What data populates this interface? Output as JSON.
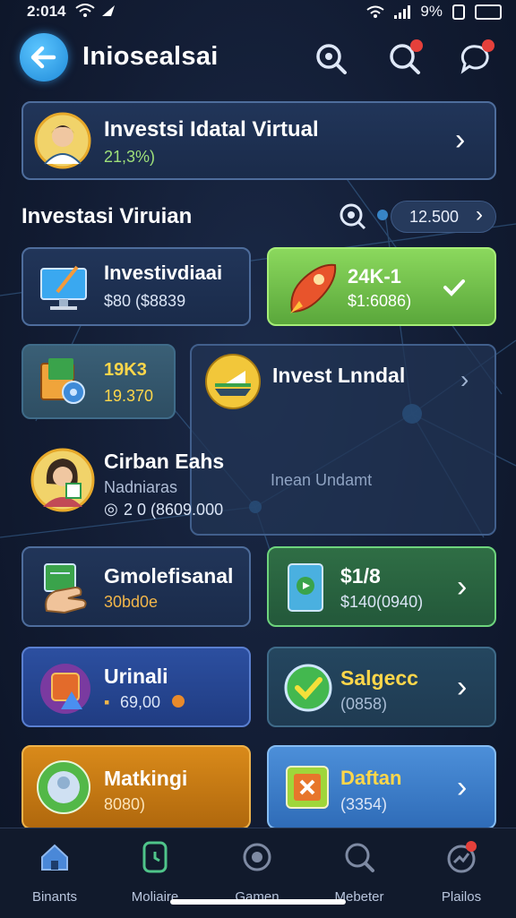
{
  "status_bar": {
    "time": "2:014",
    "battery": "9%"
  },
  "app_bar": {
    "title": "Iniosealsai"
  },
  "profile_card": {
    "title": "Investsi Idatal Virtual",
    "value": "21,3%)"
  },
  "section": {
    "title": "Investasi Viruian",
    "pill_value": "12.500"
  },
  "cards": [
    {
      "title": "Investivdiaai",
      "sub": "$80 ($8839"
    },
    {
      "title": "24K-1",
      "sub": "$1:6086)"
    },
    {
      "title": "19K3",
      "sub": "19.370"
    },
    {
      "title": "Invest Lnndal",
      "sub": ""
    },
    {
      "title": "Cirban Eahs",
      "sub": "Nadniaras",
      "amount": "2 0 (8609.000"
    },
    {
      "title": "Gmolefisanal",
      "sub": "30bd0e"
    },
    {
      "title": "$1/8",
      "sub": "$140(0940)"
    },
    {
      "title": "Urinali",
      "sub": "69,00"
    },
    {
      "title": "Salgecc",
      "sub": "(0858)"
    },
    {
      "title": "Matkingi",
      "sub": "8080)"
    },
    {
      "title": "Daftan",
      "sub": "(3354)"
    }
  ],
  "network_label": "Inean Undamt",
  "nav": [
    {
      "label": "Binants",
      "icon": "home-icon"
    },
    {
      "label": "Moliaire",
      "icon": "clock-icon"
    },
    {
      "label": "Gamen",
      "icon": "gamepad-icon"
    },
    {
      "label": "Mebeter",
      "icon": "search-icon"
    },
    {
      "label": "Plailos",
      "icon": "chart-icon"
    }
  ]
}
